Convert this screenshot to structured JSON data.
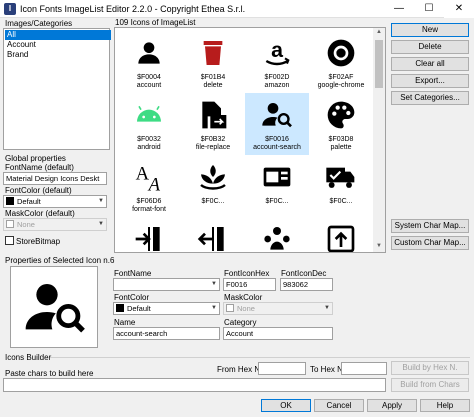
{
  "window": {
    "title": "Icon Fonts ImageList Editor 2.2.0 - Copyright Ethea S.r.l.",
    "minimize_glyph": "—",
    "maximize_glyph": "☐",
    "close_glyph": "✕"
  },
  "categories": {
    "title": "Images/Categories",
    "items": [
      "All",
      "Account",
      "Brand"
    ],
    "selected": "All"
  },
  "grid": {
    "header": "109 Icons of ImageList",
    "icons": [
      {
        "hex": "$F0004",
        "name": "account",
        "icon": "account-icon"
      },
      {
        "hex": "$F01B4",
        "name": "delete",
        "icon": "delete-icon"
      },
      {
        "hex": "$F002D",
        "name": "amazon",
        "icon": "amazon-icon"
      },
      {
        "hex": "$F02AF",
        "name": "google-chrome",
        "icon": "google-chrome-icon"
      },
      {
        "hex": "$F0032",
        "name": "android",
        "icon": "android-icon"
      },
      {
        "hex": "$F0B32",
        "name": "file-replace",
        "icon": "file-replace-icon"
      },
      {
        "hex": "$F0016",
        "name": "account-search",
        "icon": "account-search-icon",
        "selected": true
      },
      {
        "hex": "$F03D8",
        "name": "palette",
        "icon": "palette-icon"
      },
      {
        "hex": "$F06D6",
        "name": "format-font",
        "icon": "format-font-icon"
      },
      {
        "hex": "$F0C...",
        "name": "",
        "icon": "spa-icon"
      },
      {
        "hex": "$F0C...",
        "name": "",
        "icon": "card-icon"
      },
      {
        "hex": "$F0C...",
        "name": "",
        "icon": "truck-check-icon"
      },
      {
        "hex": "",
        "name": "",
        "icon": "entrance-icon"
      },
      {
        "hex": "",
        "name": "",
        "icon": "exit-icon"
      },
      {
        "hex": "",
        "name": "",
        "icon": "group-icon"
      },
      {
        "hex": "",
        "name": "",
        "icon": "upload-box-icon"
      }
    ]
  },
  "buttons": {
    "new": "New",
    "delete": "Delete",
    "clear_all": "Clear all",
    "export": "Export...",
    "set_categories": "Set Categories...",
    "system_char_map": "System Char Map...",
    "custom_char_map": "Custom Char Map...",
    "build_by_hex": "Build by Hex N.",
    "build_from_chars": "Build from Chars",
    "ok": "OK",
    "cancel": "Cancel",
    "apply": "Apply",
    "help": "Help"
  },
  "global_properties": {
    "title": "Global properties",
    "fontname_label": "FontName (default)",
    "fontname_value": "Material Design Icons Deskt",
    "fontcolor_label": "FontColor (default)",
    "fontcolor_value": "Default",
    "fontcolor_swatch": "#000000",
    "maskcolor_label": "MaskColor (default)",
    "maskcolor_value": "None",
    "storebitmap_label": "StoreBitmap"
  },
  "selected_icon": {
    "title": "Properties of Selected Icon n.6",
    "fontname_label": "FontName",
    "fontname_value": "",
    "fonticonhex_label": "FontIconHex",
    "fonticonhex_value": "F0016",
    "fonticondec_label": "FontIconDec",
    "fonticondec_value": "983062",
    "fontcolor_label": "FontColor",
    "fontcolor_value": "Default",
    "maskcolor_label": "MaskColor",
    "maskcolor_value": "None",
    "name_label": "Name",
    "name_value": "account-search",
    "category_label": "Category",
    "category_value": "Account",
    "preview_icon": "account-search-icon"
  },
  "builder": {
    "title": "Icons Builder",
    "paste_label": "Paste chars to build here",
    "from_hex_label": "From Hex N.",
    "to_hex_label": "To Hex N.",
    "from_hex_value": "",
    "to_hex_value": "",
    "paste_value": ""
  },
  "colors": {
    "selection": "#0078d7",
    "selected_cell": "#cce8ff",
    "delete_icon": "#b71c1c",
    "android_icon": "#3ddc84"
  }
}
